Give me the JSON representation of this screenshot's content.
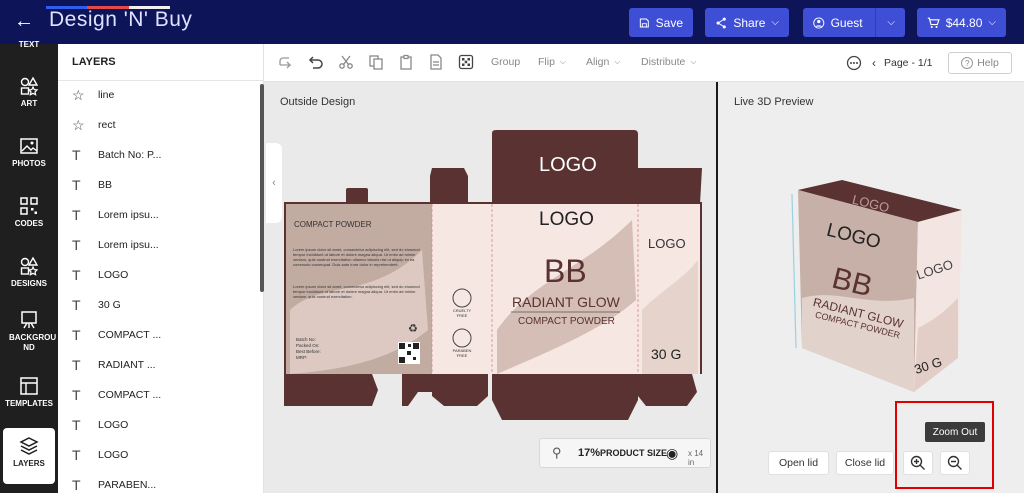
{
  "header": {
    "logo_text": "Design 'N' Buy",
    "save_label": "Save",
    "share_label": "Share",
    "guest_label": "Guest",
    "cart_label": "$44.80"
  },
  "rail": {
    "items": [
      {
        "label": "TEXT"
      },
      {
        "label": "ART"
      },
      {
        "label": "PHOTOS"
      },
      {
        "label": "CODES"
      },
      {
        "label": "DESIGNS"
      },
      {
        "label": "BACKGROU ND"
      },
      {
        "label": "TEMPLATES"
      },
      {
        "label": "LAYERS"
      }
    ]
  },
  "layers": {
    "title": "LAYERS",
    "items": [
      {
        "icon": "shapes-icon",
        "label": "line"
      },
      {
        "icon": "shapes-icon",
        "label": "rect"
      },
      {
        "icon": "text-icon",
        "label": "Batch No: P..."
      },
      {
        "icon": "text-icon",
        "label": "BB"
      },
      {
        "icon": "text-icon",
        "label": "Lorem ipsu..."
      },
      {
        "icon": "text-icon",
        "label": "Lorem ipsu..."
      },
      {
        "icon": "text-icon",
        "label": "LOGO"
      },
      {
        "icon": "text-icon",
        "label": "30 G"
      },
      {
        "icon": "text-icon",
        "label": "COMPACT ..."
      },
      {
        "icon": "text-icon",
        "label": "RADIANT ..."
      },
      {
        "icon": "text-icon",
        "label": "COMPACT ..."
      },
      {
        "icon": "text-icon",
        "label": "LOGO"
      },
      {
        "icon": "text-icon",
        "label": "LOGO"
      },
      {
        "icon": "text-icon",
        "label": "PARABEN..."
      }
    ]
  },
  "toolbar": {
    "group_label": "Group",
    "flip_label": "Flip",
    "align_label": "Align",
    "distribute_label": "Distribute",
    "page_label": "Page - 1/1",
    "help_label": "Help"
  },
  "design": {
    "title": "Outside Design",
    "panel_title": "COMPACT POWDER",
    "logo": "LOGO",
    "bb": "BB",
    "radiant": "RADIANT GLOW",
    "compact": "COMPACT POWDER",
    "side_logo": "LOGO",
    "weight": "30 G",
    "cruelty": "CRUELTY FREE",
    "paraben": "PARABEN FREE",
    "batch": "Batch No: Packed On: Best Before: MRP:",
    "lorem": "Lorem ipsum dolor sit amet, consectetur adipiscing elit, sed do eiusmod tempor incididunt ut labore et dolore magna aliqua. Ut enim ad minim veniam, quis nostrud exercitation ullamco laboris nisi ut aliquip ex ea commodo consequat. Duis aute irure dolor in reprehenderit.",
    "lorem2": "Lorem ipsum dolor sit amet, consectetur adipiscing elit, sed do eiusmod tempor incididunt ut labore et dolore magna aliqua. Ut enim ad minim veniam, quis nostrud exercitation.",
    "zoom_value": "17%",
    "product_size_label": "PRODUCT SIZE",
    "product_size_value": "x 14 in"
  },
  "preview": {
    "title": "Live 3D Preview",
    "open_lid": "Open lid",
    "close_lid": "Close lid",
    "tooltip": "Zoom Out",
    "box_logo_top": "LOGO",
    "box_logo_front": "LOGO",
    "box_bb": "BB",
    "box_radiant": "RADIANT GLOW",
    "box_compact": "COMPACT POWDER",
    "box_side_logo": "LOGO",
    "box_side_weight": "30 G"
  },
  "colors": {
    "topbar": "#0e1458",
    "button": "#3e4fd6",
    "dieline": "#5a3232",
    "panel_light": "#f5e4e0",
    "accent_red": "#e00000"
  }
}
